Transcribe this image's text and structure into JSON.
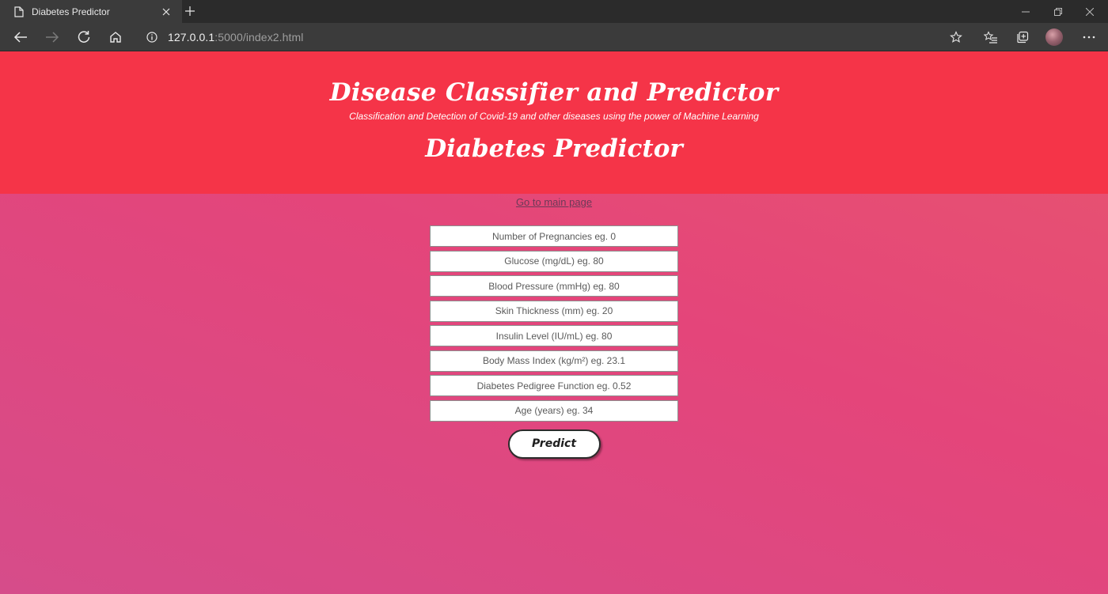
{
  "browser": {
    "tab_title": "Diabetes Predictor",
    "url_host": "127.0.0.1",
    "url_rest": ":5000/index2.html",
    "icons": [
      "page-icon",
      "close-icon",
      "plus-icon",
      "minimize-icon",
      "restore-icon",
      "back-icon",
      "forward-icon",
      "refresh-icon",
      "home-icon",
      "info-icon",
      "star-icon",
      "favorites-icon",
      "collections-icon",
      "avatar",
      "more-icon"
    ]
  },
  "header": {
    "title": "Disease Classifier and Predictor",
    "subtitle": "Classification and Detection of Covid-19 and other diseases using the power of Machine Learning",
    "page_heading": "Diabetes Predictor",
    "color": "#f53448"
  },
  "main_link": "Go to main page",
  "form": {
    "fields": [
      {
        "name": "pregnancies-input",
        "placeholder": "Number of Pregnancies eg. 0"
      },
      {
        "name": "glucose-input",
        "placeholder": "Glucose (mg/dL) eg. 80"
      },
      {
        "name": "blood-pressure-input",
        "placeholder": "Blood Pressure (mmHg) eg. 80"
      },
      {
        "name": "skin-thickness-input",
        "placeholder": "Skin Thickness (mm) eg. 20"
      },
      {
        "name": "insulin-input",
        "placeholder": "Insulin Level (IU/mL) eg. 80"
      },
      {
        "name": "bmi-input",
        "placeholder": "Body Mass Index (kg/m²) eg. 23.1"
      },
      {
        "name": "pedigree-input",
        "placeholder": "Diabetes Pedigree Function eg. 0.52"
      },
      {
        "name": "age-input",
        "placeholder": "Age (years) eg. 34"
      }
    ],
    "submit_label": "Predict"
  }
}
